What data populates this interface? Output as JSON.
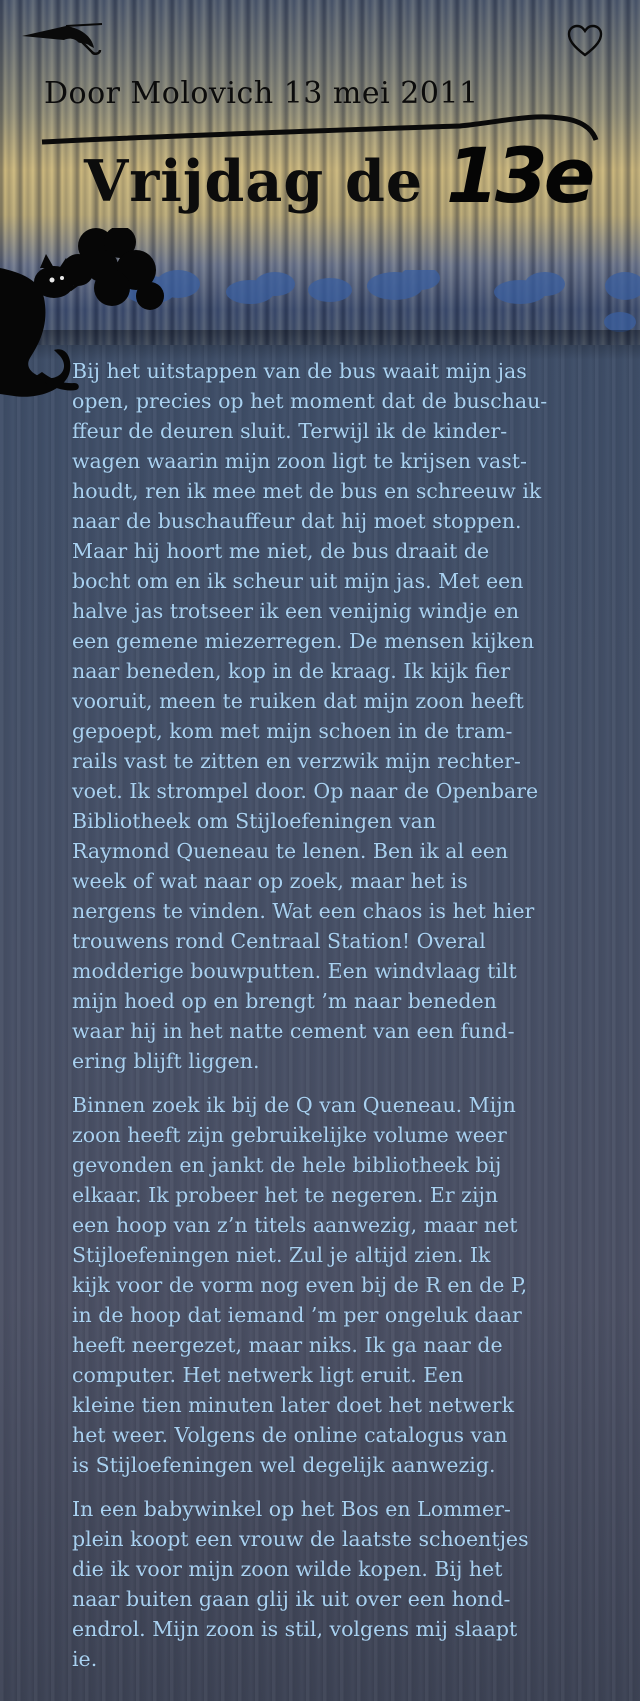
{
  "header": {
    "byline": "Door Molovich 13 mei 2011",
    "title": "Vrijdag de",
    "logo_text": "13e",
    "back_icon": "umbrella-icon",
    "favorite_icon": "heart-icon"
  },
  "colors": {
    "text": "#a9d1f0",
    "title": "#0c0c0c",
    "background": "#3e4e68"
  },
  "article": {
    "paragraphs": [
      "Bij het uitstappen van de bus waait mijn jas\nopen, precies op het moment dat de buschau-\nffeur de deuren sluit. Terwijl ik de kinder-\nwagen waarin mijn zoon ligt te krijsen vast-\nhoudt, ren ik mee met de bus en schreeuw ik\nnaar de buschauffeur dat hij moet stoppen.\nMaar hij hoort me niet, de bus draait de\nbocht om en ik scheur uit mijn jas. Met een\nhalve jas trotseer ik een venijnig windje en\neen gemene miezerregen. De mensen kijken\nnaar beneden, kop in de kraag. Ik kijk fier\nvooruit, meen te ruiken dat mijn zoon heeft\ngepoept, kom met mijn schoen in de tram-\nrails vast te zitten en verzwik mijn rechter-\nvoet. Ik strompel door. Op naar de Openbare\nBibliotheek om Stijloefeningen van\nRaymond Queneau te lenen. Ben ik al een\nweek of wat naar op zoek, maar het is\nnergens te vinden. Wat een chaos is het hier\ntrouwens rond Centraal Station! Overal\nmodderige bouwputten. Een windvlaag tilt\nmijn hoed op en brengt ’m naar beneden\nwaar hij in het natte cement van een fund-\nering blijft liggen.",
      "Binnen zoek ik bij de Q van Queneau. Mijn\nzoon heeft zijn gebruikelijke volume weer\ngevonden en jankt de hele bibliotheek bij\nelkaar. Ik probeer het te negeren. Er zijn\neen hoop van z’n titels aanwezig, maar net\nStijloefeningen niet. Zul je altijd zien. Ik\nkijk voor de vorm nog even bij de R en de P,\nin de hoop dat iemand ’m per ongeluk daar\nheeft neergezet, maar niks. Ik ga naar de\ncomputer. Het netwerk ligt eruit. Een\nkleine tien minuten later doet het netwerk\nhet weer. Volgens de online catalogus van\nis Stijloefeningen wel degelijk aanwezig.",
      "In een babywinkel op het Bos en Lommer-\nplein koopt een vrouw de laatste schoentjes\ndie ik voor mijn zoon wilde kopen. Bij het\nnaar buiten gaan glij ik uit over een hond-\nendrol. Mijn zoon is stil, volgens mij slaapt\nie."
    ]
  }
}
